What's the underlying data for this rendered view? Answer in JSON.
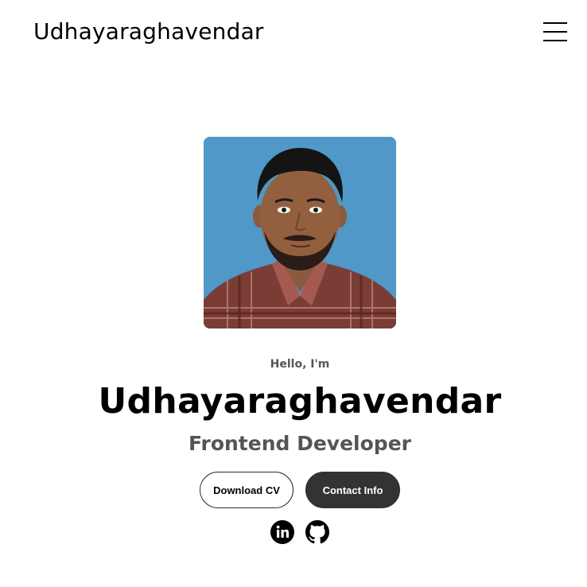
{
  "header": {
    "logo_text": "Udhayaraghavendar",
    "menu_icon": "hamburger-menu-icon"
  },
  "hero": {
    "photo_alt": "Udhayaraghavendar",
    "greeting": "Hello, I'm",
    "name": "Udhayaraghavendar",
    "role": "Frontend Developer",
    "buttons": {
      "download_cv": "Download CV",
      "contact_info": "Contact Info"
    },
    "social": [
      {
        "icon": "linkedin-icon",
        "label": "LinkedIn"
      },
      {
        "icon": "github-icon",
        "label": "GitHub"
      }
    ]
  },
  "colors": {
    "background": "#ffffff",
    "text": "#000000",
    "muted_text": "#555555",
    "button_dark": "#333333",
    "photo_background": "#4d97c6"
  }
}
